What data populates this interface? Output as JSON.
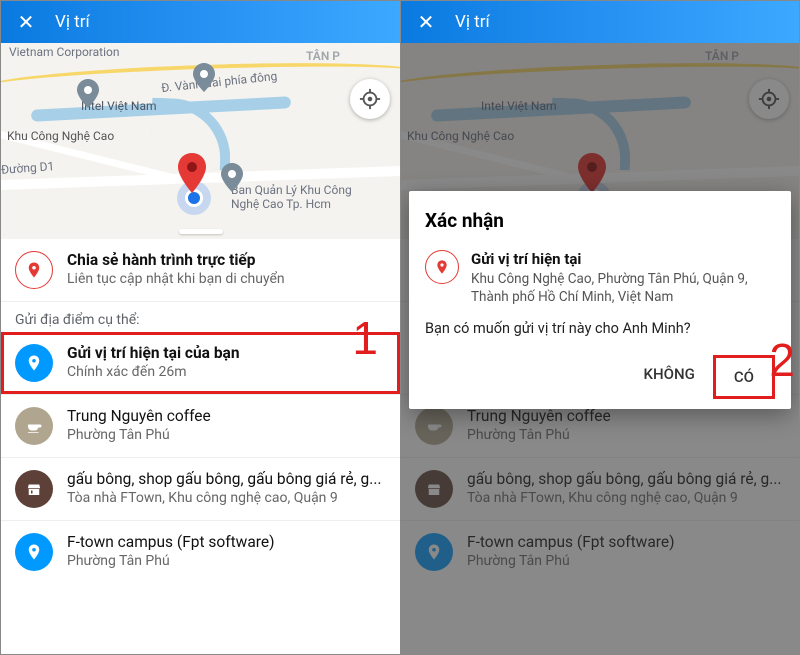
{
  "header": {
    "title": "Vị trí"
  },
  "annotations": {
    "step1": "1",
    "step2": "2"
  },
  "map": {
    "labels": {
      "vietnam_corp": "Vietnam Corporation",
      "tan_p": "TÂN P",
      "ring_road": "Đ. Vành đai phía đông",
      "intel": "Intel Việt Nam",
      "tech_park": "Khu Công Nghệ Cao",
      "d1": "Đường D1",
      "ban_ql": "Ban Quản Lý Khu Công Nghệ Cao Tp. Hcm"
    }
  },
  "share_live": {
    "title": "Chia sẻ hành trình trực tiếp",
    "subtitle": "Liên tục cập nhật khi bạn di chuyển"
  },
  "section_label": "Gửi địa điểm cụ thể:",
  "items": [
    {
      "title": "Gửi vị trí hiện tại của bạn",
      "subtitle": "Chính xác đến 26m",
      "icon": "location",
      "color": "#0099ff"
    },
    {
      "title": "Trung Nguyên coffee",
      "subtitle": "Phường Tân Phú",
      "icon": "coffee",
      "color": "#8a6d3b"
    },
    {
      "title": "gấu bông, shop gấu bông, gấu bông giá rẻ, g...",
      "subtitle": "Tòa nhà FTown, Khu công nghệ cao, Quận 9",
      "icon": "shop",
      "color": "#5d4037"
    },
    {
      "title": "F-town campus (Fpt software)",
      "subtitle": "Phường Tân Phú",
      "icon": "location",
      "color": "#0099ff"
    }
  ],
  "dialog": {
    "title": "Xác nhận",
    "item_title": "Gửi vị trí hiện tại",
    "item_subtitle": "Khu Công Nghệ Cao, Phường Tân Phú, Quận 9, Thành phố Hồ Chí Minh, Việt Nam",
    "question": "Bạn có muốn gửi vị trí này cho Anh Minh?",
    "no": "KHÔNG",
    "yes": "CÓ"
  }
}
